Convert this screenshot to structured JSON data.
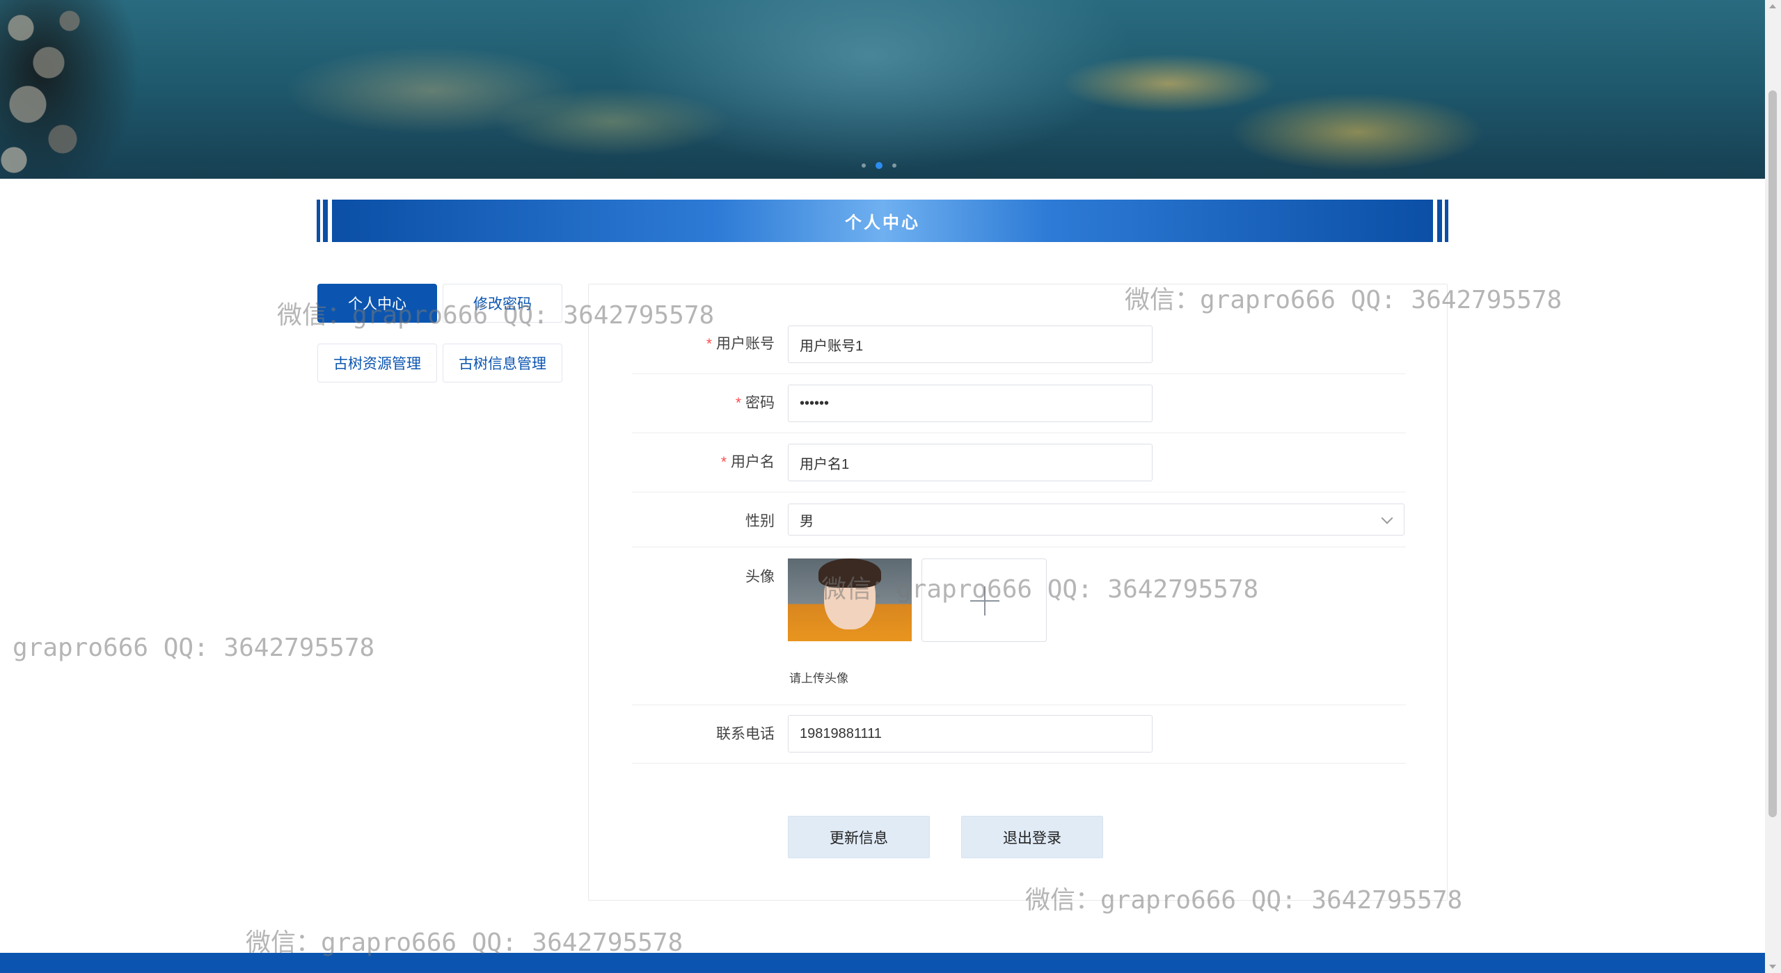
{
  "page_title": "个人中心",
  "side_menu": [
    {
      "label": "个人中心",
      "active": true
    },
    {
      "label": "修改密码",
      "active": false
    },
    {
      "label": "古树资源管理",
      "active": false
    },
    {
      "label": "古树信息管理",
      "active": false
    }
  ],
  "form": {
    "account": {
      "label": "用户账号",
      "required": true,
      "value": "用户账号1"
    },
    "password": {
      "label": "密码",
      "required": true,
      "value": "••••••"
    },
    "username": {
      "label": "用户名",
      "required": true,
      "value": "用户名1"
    },
    "gender": {
      "label": "性别",
      "value": "男"
    },
    "avatar": {
      "label": "头像",
      "hint": "请上传头像"
    },
    "phone": {
      "label": "联系电话",
      "value": "19819881111"
    }
  },
  "buttons": {
    "update": "更新信息",
    "logout": "退出登录"
  },
  "carousel": {
    "count": 3,
    "active_index": 1
  },
  "watermark_text": "微信：grapro666 QQ: 3642795578",
  "colors": {
    "primary": "#0b55b0",
    "required": "#ff4d4f",
    "button_bg": "#e1ebf6"
  }
}
